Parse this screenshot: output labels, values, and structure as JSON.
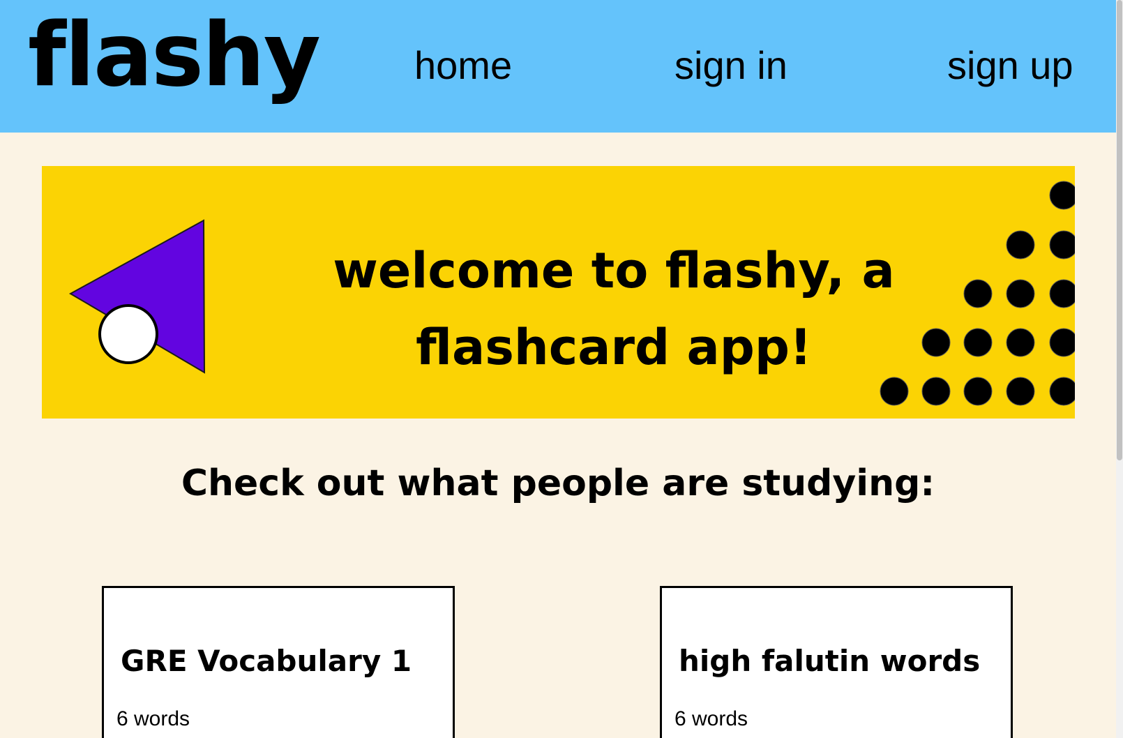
{
  "nav": {
    "logo": "flashy",
    "links": [
      {
        "label": "home"
      },
      {
        "label": "sign in"
      },
      {
        "label": "sign up"
      }
    ]
  },
  "colors": {
    "navbar": "#64c3fb",
    "background": "#fbf3e4",
    "banner": "#fbd304",
    "triangle": "#6205e0",
    "dots": "#000000"
  },
  "banner": {
    "line1": "welcome to flashy, a",
    "line2": "flashcard app!"
  },
  "section": {
    "heading": "Check out what people are studying:"
  },
  "decks": [
    {
      "title": "GRE Vocabulary 1",
      "count": "6 words"
    },
    {
      "title": "high falutin words",
      "count": "6 words"
    }
  ]
}
